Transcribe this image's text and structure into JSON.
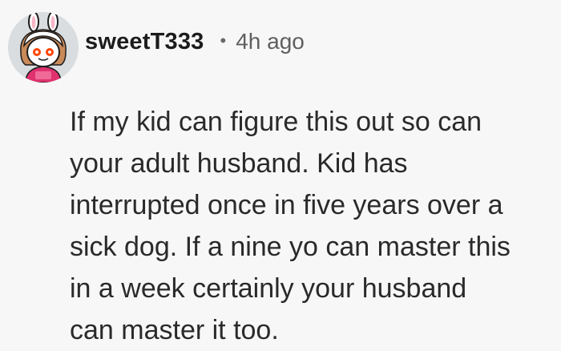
{
  "comment": {
    "author": "sweetT333",
    "separator": "•",
    "timestamp": "4h ago",
    "avatar_icon": "snoo-bunny-avatar-icon",
    "body": "If my kid can figure this out so can\nyour adult husband. Kid has\ninterrupted once in five years over a\nsick dog. If a nine yo can master this\nin a week certainly your husband\ncan master it too."
  },
  "colors": {
    "background": "#f7f7f7",
    "text": "#2a2a2a",
    "meta": "#5f5f5f",
    "avatar_bg": "#d9dde0",
    "avatar_shirt": "#e0316f"
  }
}
